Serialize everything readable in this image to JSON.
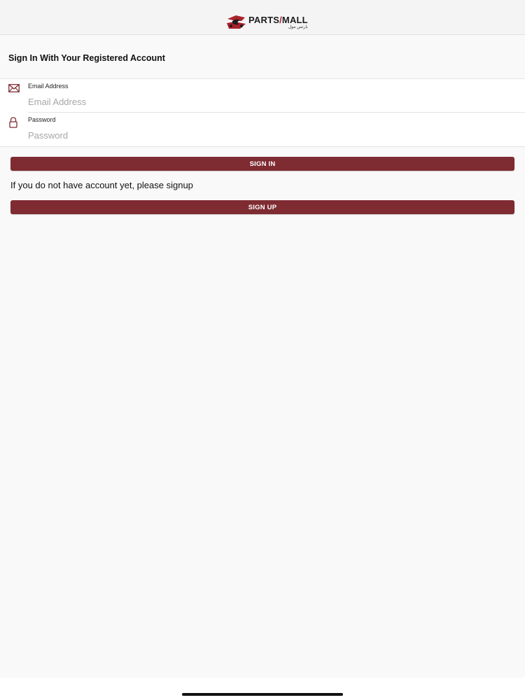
{
  "header": {
    "logo": {
      "text_main": "PARTS",
      "text_slash": "/",
      "text_end": "MALL",
      "text_sub": "بارتس مول"
    }
  },
  "signin": {
    "title": "Sign In With Your Registered Account",
    "email": {
      "label": "Email Address",
      "placeholder": "Email Address",
      "value": "",
      "icon": "envelope-icon"
    },
    "password": {
      "label": "Password",
      "placeholder": "Password",
      "value": "",
      "icon": "lock-icon"
    },
    "sign_in_button": "SIGN IN",
    "signup_hint": "If you do not have account yet, please signup",
    "sign_up_button": "SIGN UP"
  },
  "colors": {
    "accent": "#7e2b32",
    "logo_red": "#a8232c",
    "background": "#faf9f9"
  }
}
